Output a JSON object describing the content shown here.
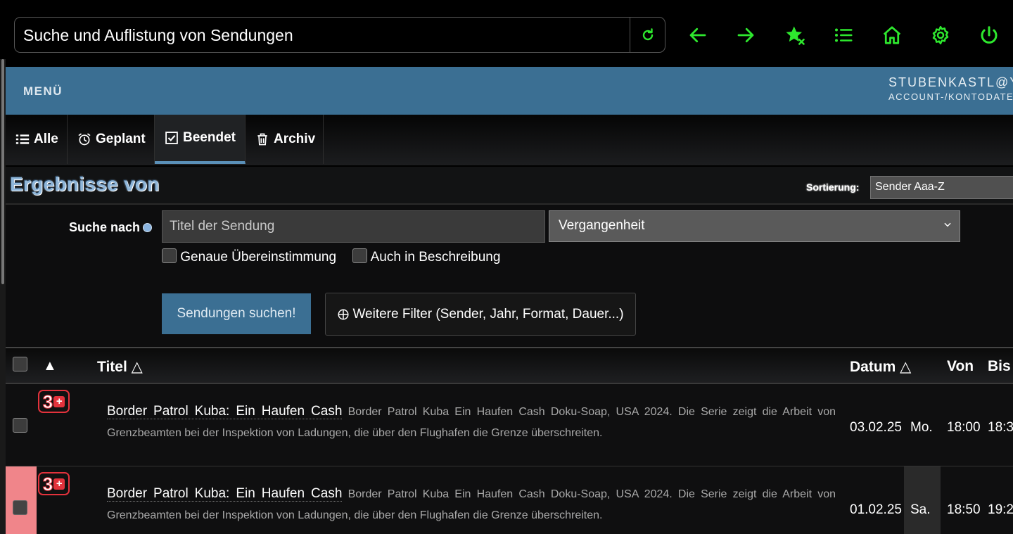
{
  "browser": {
    "url_text": "Suche und Auflistung von Sendungen",
    "icons": [
      "reload-icon",
      "back-arrow-icon",
      "forward-arrow-icon",
      "favorites-star-icon",
      "list-icon",
      "home-icon",
      "settings-gear-icon",
      "power-icon"
    ],
    "accent_color": "#2ee82e"
  },
  "header": {
    "menu_label": "MENÜ",
    "account_email": "STUBENKASTL@Y",
    "account_sub": "ACCOUNT-/KONTODATE",
    "background_color": "#3b6f93"
  },
  "tabs": [
    {
      "label": "Alle",
      "icon": "list-bullets-icon"
    },
    {
      "label": "Geplant",
      "icon": "alarm-clock-icon"
    },
    {
      "label": "Beendet",
      "icon": "checkbox-checked-icon",
      "active": true
    },
    {
      "label": "Archiv",
      "icon": "trash-icon"
    }
  ],
  "results": {
    "title": "Ergebnisse von",
    "sort_label": "Sortierung:",
    "sort_value": "Sender Aaa-Z"
  },
  "search": {
    "label": "Suche nach",
    "title_placeholder": "Titel der Sendung",
    "time_value": "Vergangenheit",
    "exact_match_label": "Genaue Übereinstimmung",
    "in_description_label": "Auch in Beschreibung",
    "search_button": "Sendungen suchen!",
    "more_filters_button": "Weitere Filter (Sender, Jahr, Format, Dauer...)"
  },
  "table": {
    "sort_indicator": "▲",
    "columns": {
      "titel": "Titel △",
      "datum": "Datum △",
      "von": "Von",
      "bis": "Bis"
    },
    "rows": [
      {
        "channel": "3+",
        "title": "Border Patrol Kuba: Ein Haufen Cash",
        "description": "Border Patrol Kuba Ein Haufen Cash Doku-Soap, USA 2024. Die Serie zeigt die Arbeit von Grenzbeamten bei der Inspektion von Ladungen, die über den Flughafen die Grenze überschreiten.",
        "date": "03.02.25",
        "day": "Mo.",
        "from": "18:00",
        "to": "18:3",
        "flagged": false
      },
      {
        "channel": "3+",
        "title": "Border Patrol Kuba: Ein Haufen Cash",
        "description": "Border Patrol Kuba Ein Haufen Cash Doku-Soap, USA 2024. Die Serie zeigt die Arbeit von Grenzbeamten bei der Inspektion von Ladungen, die über den Flughafen die Grenze überschreiten.",
        "date": "01.02.25",
        "day": "Sa.",
        "from": "18:50",
        "to": "19:2",
        "flagged": true
      }
    ]
  }
}
